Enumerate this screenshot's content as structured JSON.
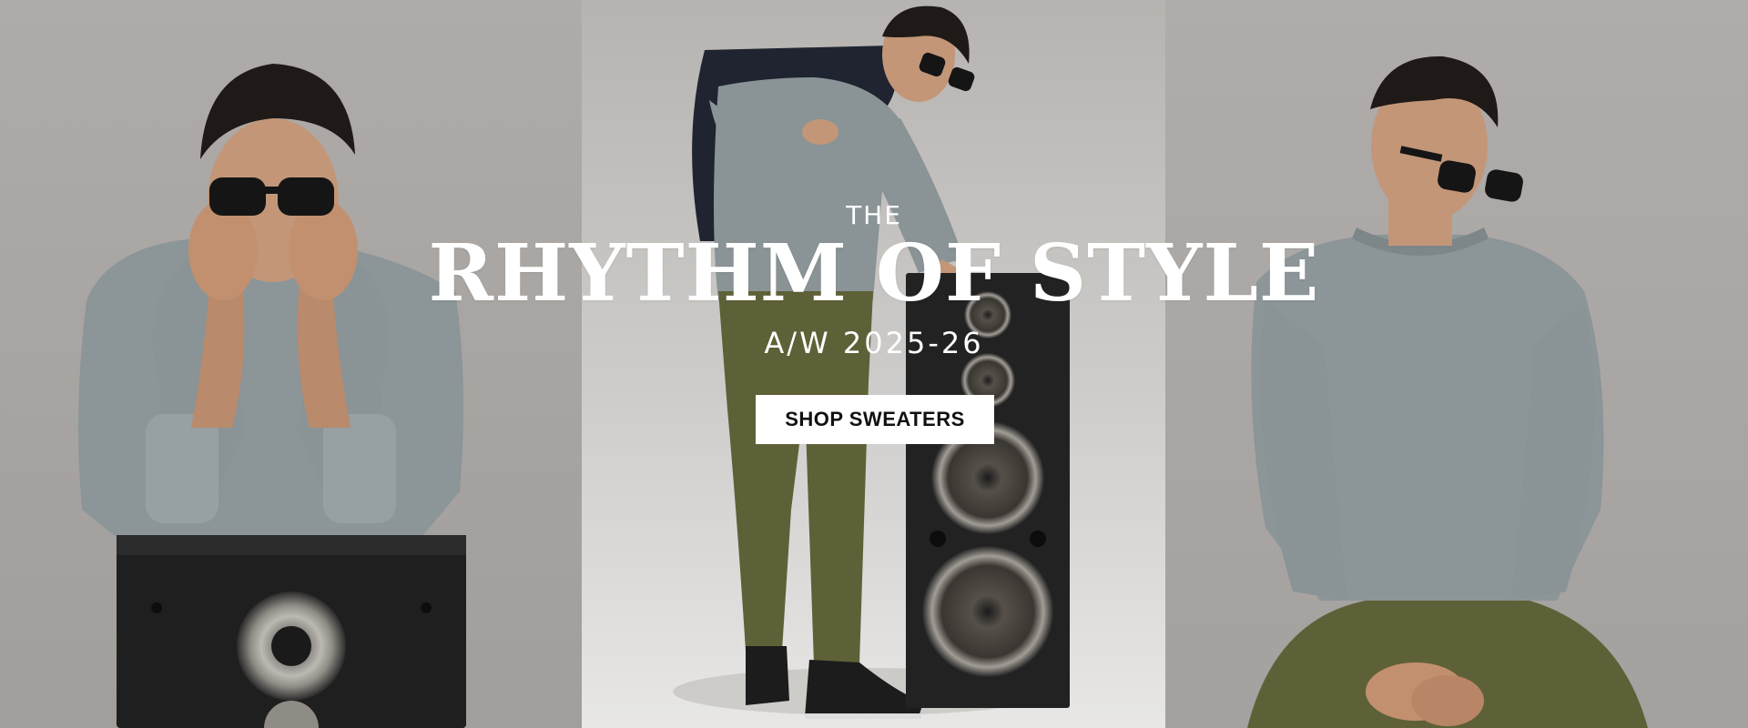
{
  "hero": {
    "kicker": "THE",
    "headline": "RHYTHM OF STYLE",
    "season": "A/W 2025-26",
    "cta_label": "SHOP SWEATERS"
  },
  "panels": [
    {
      "subject": "model-hands-on-face",
      "icon": "person-photo"
    },
    {
      "subject": "model-with-speaker",
      "icon": "person-photo"
    },
    {
      "subject": "model-seated",
      "icon": "person-photo"
    }
  ],
  "colors": {
    "backdrop_left": "#a9a6a3",
    "backdrop_center": "#b9b7b5",
    "backdrop_right": "#aaa8a6",
    "sweater": "#8a9396",
    "trousers": "#5e6137",
    "speaker": "#1f1f1f",
    "cta_bg": "#ffffff",
    "cta_text": "#111111",
    "text": "#ffffff"
  }
}
